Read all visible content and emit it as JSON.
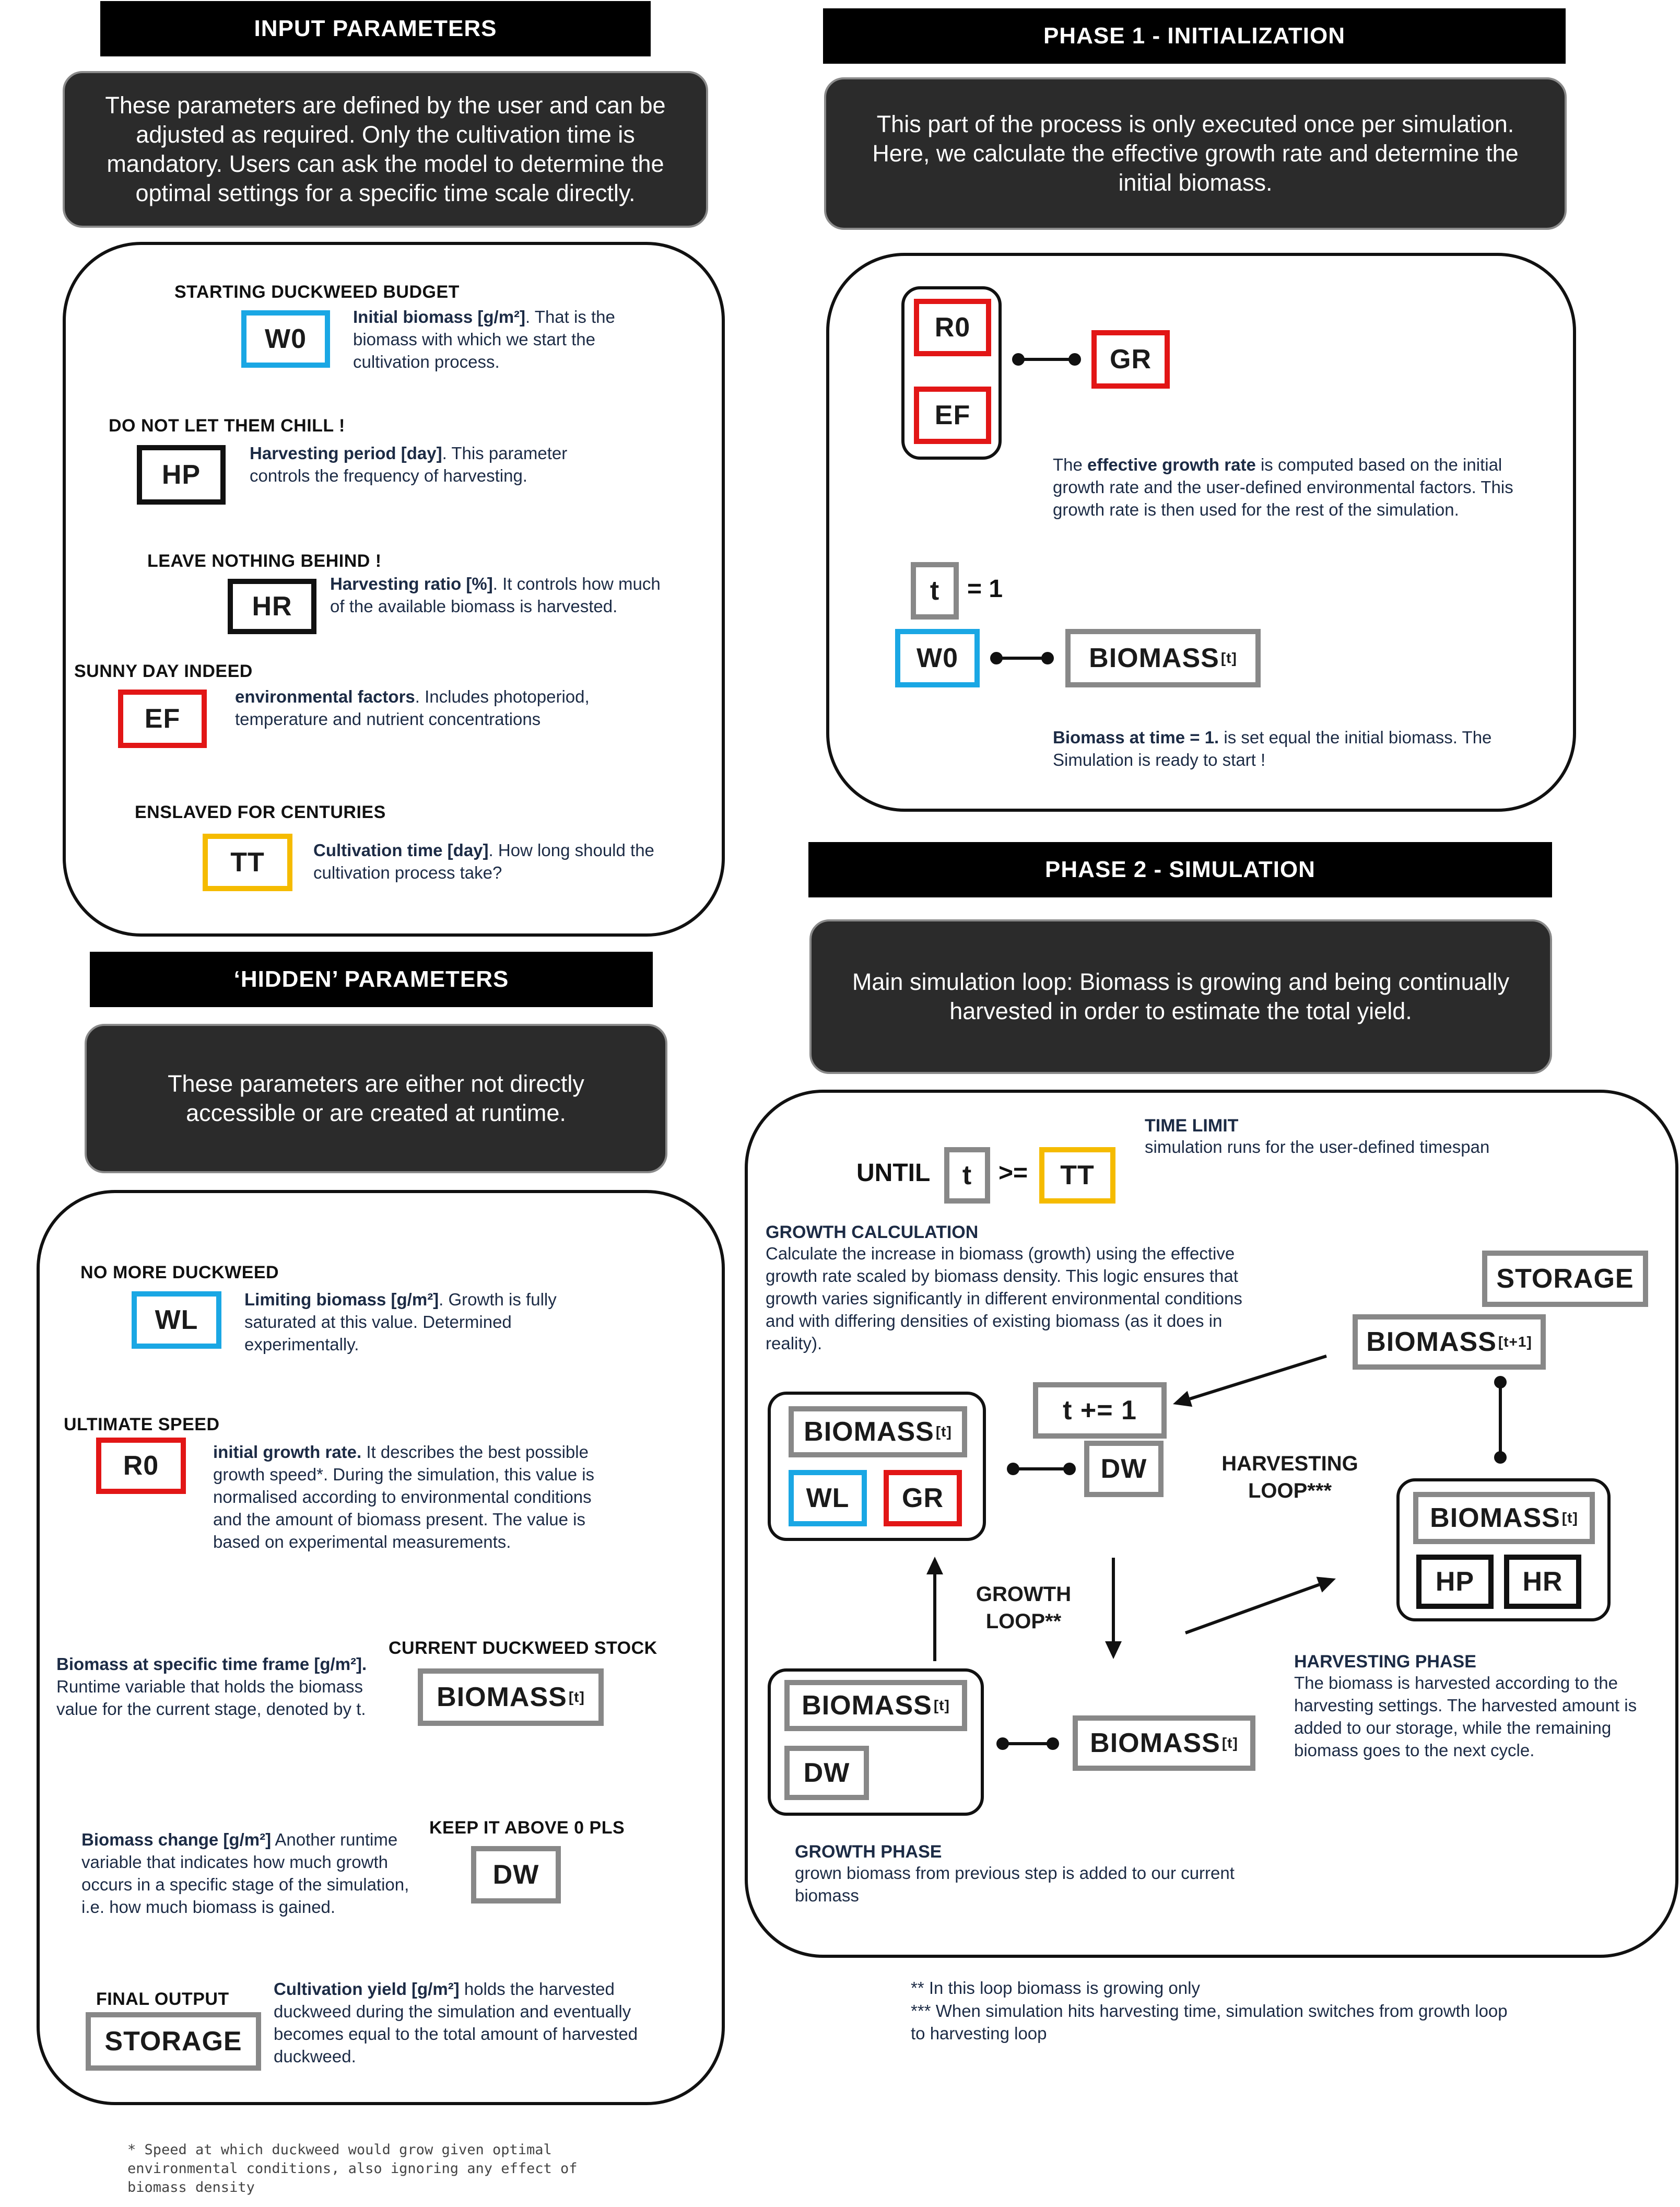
{
  "input": {
    "header": "INPUT PARAMETERS",
    "intro": "These parameters are defined by the user and can be adjusted as required. Only the cultivation time is mandatory. Users can ask the model to determine the optimal settings for a specific time scale directly.",
    "items": [
      {
        "title": "STARTING DUCKWEED BUDGET",
        "code": "W0",
        "bold": "Initial biomass [g/m²]",
        "text": ". That is the biomass with which we start the cultivation process."
      },
      {
        "title": "DO NOT LET THEM CHILL !",
        "code": "HP",
        "bold": "Harvesting period [day]",
        "text": ". This parameter controls the frequency of harvesting."
      },
      {
        "title": "LEAVE NOTHING BEHIND !",
        "code": "HR",
        "bold": "Harvesting ratio [%]",
        "text": ". It controls how much of the available biomass is harvested."
      },
      {
        "title": "SUNNY DAY INDEED",
        "code": "EF",
        "bold": "environmental factors",
        "text": ". Includes photoperiod, temperature and nutrient concentrations"
      },
      {
        "title": "ENSLAVED FOR CENTURIES",
        "code": "TT",
        "bold": "Cultivation time [day]",
        "text": ". How long should the cultivation process take?"
      }
    ]
  },
  "hidden": {
    "header": "‘HIDDEN’ PARAMETERS",
    "intro": "These parameters are either not directly accessible or are created at runtime.",
    "items": [
      {
        "title": "NO MORE DUCKWEED",
        "code": "WL",
        "bold": "Limiting biomass [g/m²]",
        "text": ". Growth is fully saturated at this value. Determined experimentally."
      },
      {
        "title": "ULTIMATE SPEED",
        "code": "R0",
        "bold": "initial growth rate.",
        "text": " It describes the best possible growth speed*. During the simulation, this value is normalised according to environmental conditions and the amount of biomass present. The value is based on experimental measurements."
      },
      {
        "title": "CURRENT DUCKWEED STOCK",
        "code": "BIOMASS",
        "sup": "[t]",
        "bold": "Biomass at specific time frame [g/m²].",
        "text": " Runtime variable that holds the biomass value for the current stage, denoted by t."
      },
      {
        "title": "KEEP IT ABOVE 0 PLS",
        "code": "DW",
        "bold": "Biomass change [g/m²]",
        "text": " Another runtime variable that indicates how much growth occurs in a specific stage of the simulation, i.e. how much biomass is gained."
      },
      {
        "title": "FINAL OUTPUT",
        "code": "STORAGE",
        "bold": "Cultivation yield [g/m²]",
        "text": " holds the harvested duckweed during the simulation and eventually becomes equal to the total amount of harvested duckweed."
      }
    ],
    "footnote": "* Speed at which duckweed would grow given optimal environmental conditions, also ignoring any effect of biomass density"
  },
  "phase1": {
    "header": "PHASE 1 - INITIALIZATION",
    "intro": "This part of the process is only executed once per simulation. Here, we calculate the effective growth rate and determine the initial biomass.",
    "r0": "R0",
    "ef": "EF",
    "gr": "GR",
    "gr_desc_pre": "The ",
    "gr_desc_bold": "effective growth rate",
    "gr_desc_post": " is computed based on the initial growth rate and the user-defined environmental factors. This growth rate is then used for the rest of the simulation.",
    "t": "t",
    "t_eq": "= 1",
    "w0": "W0",
    "biomass": "BIOMASS",
    "biomass_sup": "[t]",
    "init_bold": "Biomass at time = 1.",
    "init_text": " is set equal the initial biomass. The Simulation is ready to start !"
  },
  "phase2": {
    "header": "PHASE 2 - SIMULATION",
    "intro": "Main simulation loop: Biomass is growing and being continually harvested in order to estimate the total yield.",
    "until": "UNTIL",
    "t": "t",
    "ge": ">=",
    "tt": "TT",
    "time_limit_title": "TIME LIMIT",
    "time_limit_text": "simulation runs for the user-defined timespan",
    "growth_calc_title": "GROWTH CALCULATION",
    "growth_calc_text": "Calculate the increase in biomass (growth) using the effective growth rate scaled by biomass density. This logic ensures that growth varies significantly in different environmental conditions and with differing densities of existing biomass (as it does in reality).",
    "storage": "STORAGE",
    "biomass": "BIOMASS",
    "sup_t": "[t]",
    "sup_t1": "[t+1]",
    "wl": "WL",
    "gr": "GR",
    "t_inc": "t += 1",
    "dw": "DW",
    "hp": "HP",
    "hr": "HR",
    "harvesting_loop": "HARVESTING\nLOOP***",
    "growth_loop": "GROWTH\nLOOP**",
    "harvest_title": "HARVESTING PHASE",
    "harvest_text": "The biomass is harvested according to the harvesting settings. The harvested amount is added to our storage, while the remaining biomass goes to the next cycle.",
    "growth_phase_title": "GROWTH PHASE",
    "growth_phase_text": "grown biomass from previous step is added to our current biomass",
    "notes": [
      "** In this loop biomass is growing only",
      "*** When simulation hits harvesting time, simulation switches from growth loop to harvesting loop"
    ]
  },
  "colors": {
    "blue": "#1aa7e4",
    "red": "#e21616",
    "yellow": "#f5bb00",
    "gray": "#888888",
    "black": "#111111"
  }
}
